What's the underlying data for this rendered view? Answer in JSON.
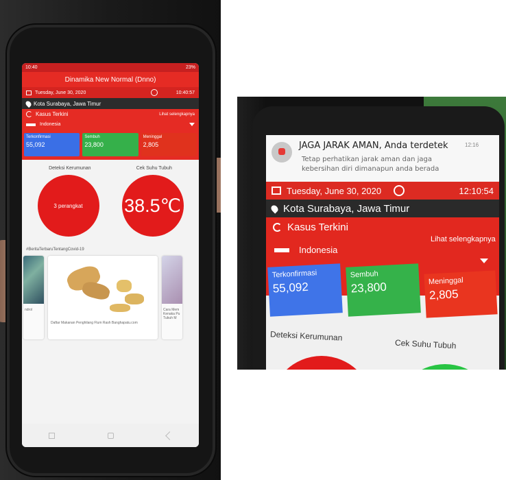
{
  "left_phone": {
    "status_time": "10:40",
    "status_battery": "23%",
    "app_title": "Dinamika New Normal (Dnno)",
    "date": "Tuesday, June 30, 2020",
    "time": "10:40:57",
    "location": "Kota Surabaya, Jawa Timur",
    "cases_title": "Kasus Terkini",
    "see_more": "Lihat selengkapnya",
    "country": "Indonesia",
    "cards": [
      {
        "label": "Terkonfirmasi",
        "value": "55,092",
        "color": "#3a6fe6"
      },
      {
        "label": "Sembuh",
        "value": "23,800",
        "color": "#35b04a"
      },
      {
        "label": "Meninggal",
        "value": "2,805",
        "color": "#e0321d"
      }
    ],
    "crowd_label": "Deteksi Kerumunan",
    "temp_label": "Cek Suhu Tubuh",
    "crowd_value": "3 perangkat",
    "temp_value": "38.5℃",
    "news_heading": "#BeritaTerbaruTentangCovid-19",
    "news_left_caption": "ndrol",
    "news_main_caption": "Daftar Makanan Penghilang Flum Rash Banghapatu.com",
    "news_right_caption": "Cara Mem Kenaka Pu Tubuh M"
  },
  "right_phone": {
    "notif_title": "JAGA JARAK AMAN, Anda terdetek",
    "notif_time": "12:16",
    "notif_body_1": "Tetap perhatikan jarak aman dan jaga",
    "notif_body_2": "kebersihan diri dimanapun anda berada",
    "date": "Tuesday, June 30, 2020",
    "time": "12:10:54",
    "location": "Kota Surabaya, Jawa Timur",
    "cases_title": "Kasus Terkini",
    "see_more": "Lihat selengkapnya",
    "country": "Indonesia",
    "cards": [
      {
        "label": "Terkonfirmasi",
        "value": "55,092"
      },
      {
        "label": "Sembuh",
        "value": "23,800"
      },
      {
        "label": "Meninggal",
        "value": "2,805"
      }
    ],
    "crowd_label": "Deteksi Kerumunan",
    "temp_label": "Cek Suhu Tubuh"
  }
}
